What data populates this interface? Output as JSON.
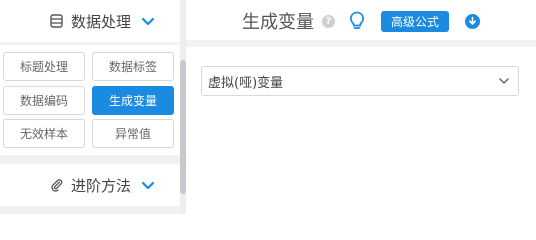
{
  "sidebar": {
    "data_section": {
      "title": "数据处理",
      "icon": "database-icon",
      "chevron_icon": "chevron-down-icon"
    },
    "buttons": [
      {
        "label": "标题处理",
        "active": false
      },
      {
        "label": "数据标签",
        "active": false
      },
      {
        "label": "数据编码",
        "active": false
      },
      {
        "label": "生成变量",
        "active": true
      },
      {
        "label": "无效样本",
        "active": false
      },
      {
        "label": "异常值",
        "active": false
      }
    ],
    "advanced_section": {
      "title": "进阶方法",
      "icon": "paperclip-icon",
      "chevron_icon": "chevron-down-icon"
    }
  },
  "main": {
    "title": "生成变量",
    "help_icon": "question-circle-icon",
    "help_glyph": "?",
    "bulb_icon": "lightbulb-icon",
    "advanced_formula_label": "高级公式",
    "download_icon": "download-circle-icon",
    "select": {
      "value": "虚拟(哑)变量",
      "chevron_icon": "chevron-down-icon"
    }
  },
  "colors": {
    "accent": "#1a8be0",
    "background": "#f1f2f4"
  }
}
